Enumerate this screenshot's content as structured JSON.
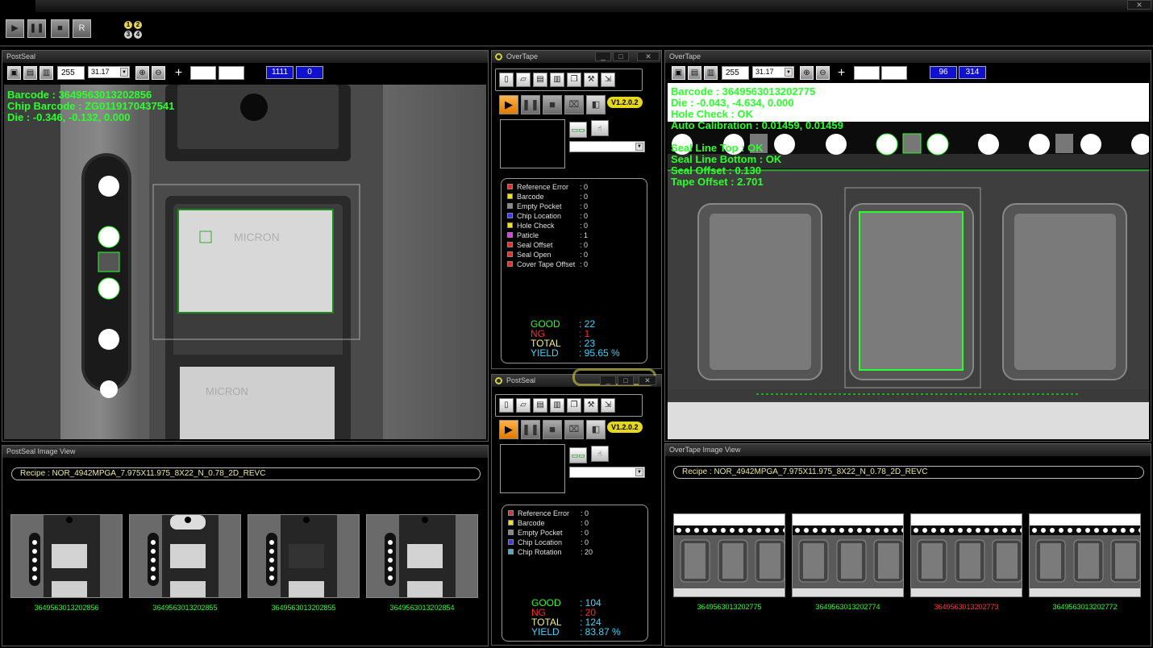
{
  "topbar": {
    "controls": [
      "▶",
      "❚❚",
      "■",
      "R"
    ],
    "badges": [
      "1",
      "2",
      "3",
      "4"
    ],
    "window_buttons": [
      "_",
      "□",
      "✕"
    ]
  },
  "postseal_cam": {
    "title": "PostSeal",
    "exposure": "255",
    "zoom": "31.17",
    "count_a": "1111",
    "count_b": "0",
    "overlay": [
      "Barcode : 3649563013202856",
      "Chip Barcode : ZG0119170437541",
      "Die : -0.346, -0.132, 0.000"
    ]
  },
  "overtape_cam": {
    "title": "OverTape",
    "exposure": "255",
    "zoom": "31.17",
    "count_a": "96",
    "count_b": "314",
    "overlay": [
      "Barcode : 3649563013202775",
      "Die : -0.043, -4.634, 0.000",
      "Hole Check : OK",
      "Auto Calibration : 0.01459, 0.01459",
      "",
      "Seal Line Top : OK",
      "Seal Line Bottom : OK",
      "Seal Offset : 0.130",
      "Tape Offset : 2.701"
    ]
  },
  "overtape_ctrl": {
    "title": "OverTape",
    "version": "V1.2.0.2",
    "window_buttons": [
      "_",
      "□",
      "✕"
    ],
    "errors": [
      {
        "label": "Reference Error",
        "value": ": 0",
        "color": "#e03030"
      },
      {
        "label": "Barcode",
        "value": ": 0",
        "color": "#f0e020"
      },
      {
        "label": "Empty Pocket",
        "value": ": 0",
        "color": "#888888"
      },
      {
        "label": "Chip Location",
        "value": ": 0",
        "color": "#3a3aff"
      },
      {
        "label": "Hole Check",
        "value": ": 0",
        "color": "#f0e020"
      },
      {
        "label": "Paticle",
        "value": ": 1",
        "color": "#e040e0"
      },
      {
        "label": "Seal Offset",
        "value": ": 0",
        "color": "#e03030"
      },
      {
        "label": "Seal Open",
        "value": ": 0",
        "color": "#e03030"
      },
      {
        "label": "Cover Tape Offset",
        "value": ": 0",
        "color": "#e03030"
      }
    ],
    "stats": [
      {
        "label": "GOOD",
        "value": ": 22",
        "color": "#2bff2b"
      },
      {
        "label": "NG",
        "value": ": 1",
        "color": "#ff2b2b"
      },
      {
        "label": "TOTAL",
        "value": ": 23",
        "color": "#f2f280"
      },
      {
        "label": "YIELD",
        "value": ": 95.65 %",
        "color": "#3ad7ff"
      }
    ]
  },
  "postseal_ctrl": {
    "title": "PostSeal",
    "version": "V1.2.0.2",
    "window_buttons": [
      "_",
      "□",
      "✕"
    ],
    "errors": [
      {
        "label": "Reference Error",
        "value": ": 0",
        "color": "#e03030"
      },
      {
        "label": "Barcode",
        "value": ": 0",
        "color": "#f0e020"
      },
      {
        "label": "Empty Pocket",
        "value": ": 0",
        "color": "#888888"
      },
      {
        "label": "Chip Location",
        "value": ": 0",
        "color": "#3a3aff"
      },
      {
        "label": "Chip Rotation",
        "value": ": 20",
        "color": "#3ab7c7"
      }
    ],
    "stats": [
      {
        "label": "GOOD",
        "value": ": 104",
        "color": "#2bff2b"
      },
      {
        "label": "NG",
        "value": ": 20",
        "color": "#ff2b2b"
      },
      {
        "label": "TOTAL",
        "value": ": 124",
        "color": "#f2f280"
      },
      {
        "label": "YIELD",
        "value": ": 83.87 %",
        "color": "#3ad7ff"
      }
    ]
  },
  "postseal_images": {
    "title": "PostSeal Image View",
    "recipe": "Recipe : NOR_4942MPGA_7.975X11.975_8X22_N_0.78_2D_REVC",
    "thumbs": [
      {
        "caption": "3649563013202856",
        "status": "ok"
      },
      {
        "caption": "3649563013202855",
        "status": "ok"
      },
      {
        "caption": "3649563013202855",
        "status": "ok"
      },
      {
        "caption": "3649563013202854",
        "status": "ok"
      }
    ]
  },
  "overtape_images": {
    "title": "OverTape Image View",
    "recipe": "Recipe : NOR_4942MPGA_7.975X11.975_8X22_N_0.78_2D_REVC",
    "thumbs": [
      {
        "caption": "3649563013202775",
        "status": "ok"
      },
      {
        "caption": "3649563013202774",
        "status": "ok"
      },
      {
        "caption": "3649563013202773",
        "status": "ng"
      },
      {
        "caption": "3649563013202772",
        "status": "ok"
      }
    ]
  }
}
